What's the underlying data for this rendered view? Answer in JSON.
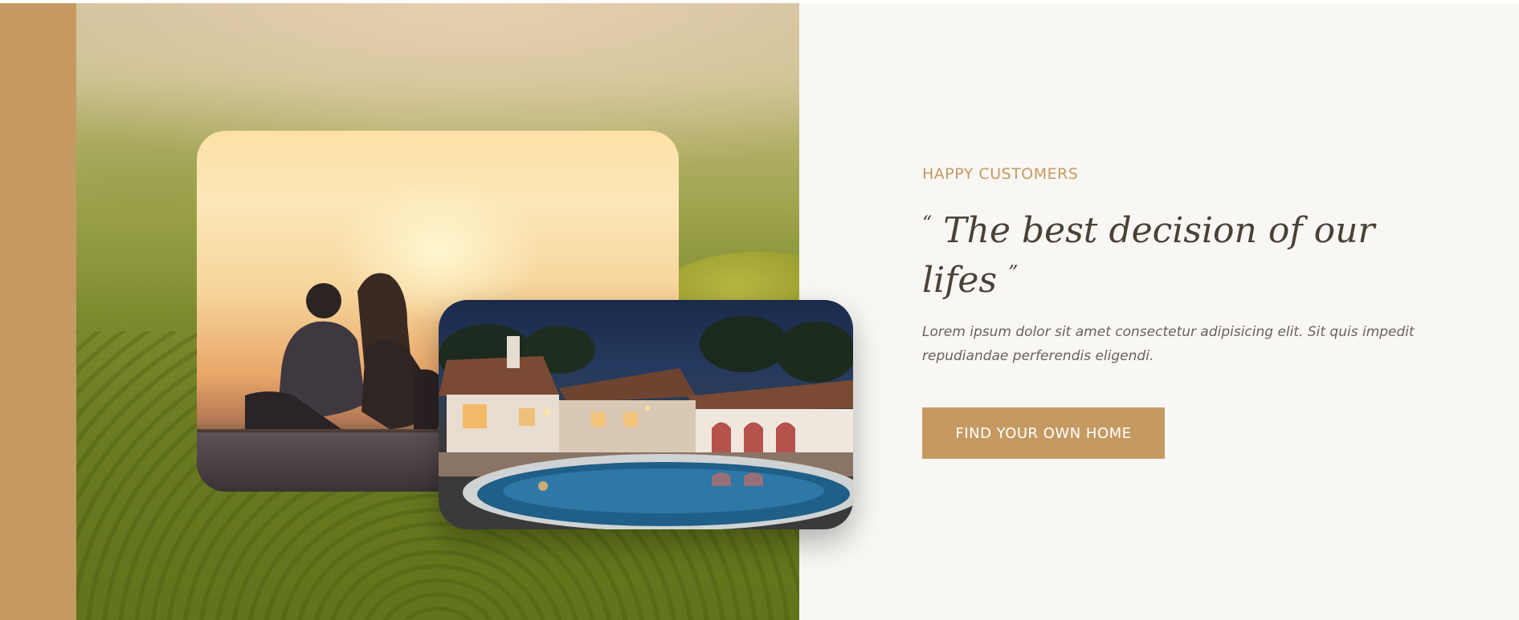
{
  "section": {
    "eyebrow": "HAPPY CUSTOMERS",
    "quote_open": "“",
    "headline": "The best decision of our lifes",
    "quote_close": "”",
    "body": "Lorem ipsum dolor sit amet consectetur adipisicing elit. Sit quis impedit repudiandae perferendis eligendi.",
    "cta_label": "FIND YOUR OWN HOME"
  },
  "colors": {
    "accent": "#c59a62",
    "heading": "#4a4137",
    "body_text": "#6a625a",
    "background": "#f9f7f4"
  }
}
